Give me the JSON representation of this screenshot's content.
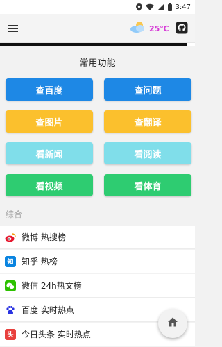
{
  "status_bar": {
    "time": "3:47"
  },
  "weather": {
    "temperature": "25℃"
  },
  "progress": {
    "fraction": 0.96
  },
  "main": {
    "section_title": "常用功能",
    "buttons": [
      {
        "label": "查百度",
        "color": "#1e88e5"
      },
      {
        "label": "查问题",
        "color": "#1e88e5"
      },
      {
        "label": "查图片",
        "color": "#fbc02d"
      },
      {
        "label": "查翻译",
        "color": "#fbc02d"
      },
      {
        "label": "看新闻",
        "color": "#80deea"
      },
      {
        "label": "看阅读",
        "color": "#80deea"
      },
      {
        "label": "看视频",
        "color": "#2ecc71"
      },
      {
        "label": "看体育",
        "color": "#2ecc71"
      }
    ]
  },
  "list": {
    "header": "综合",
    "items": [
      {
        "label": "微博 热搜榜",
        "icon": "weibo-icon"
      },
      {
        "label": "知乎 热榜",
        "icon": "zhihu-icon",
        "icon_text": "知"
      },
      {
        "label": "微信 24h热文榜",
        "icon": "wechat-icon"
      },
      {
        "label": "百度 实时热点",
        "icon": "baidu-icon"
      },
      {
        "label": "今日头条 实时热点",
        "icon": "toutiao-icon",
        "icon_text": "头"
      }
    ]
  },
  "colors": {
    "accent_blue": "#1e88e5",
    "accent_yellow": "#fbc02d",
    "accent_cyan": "#80deea",
    "accent_green": "#2ecc71",
    "temperature": "#d63bd6"
  }
}
